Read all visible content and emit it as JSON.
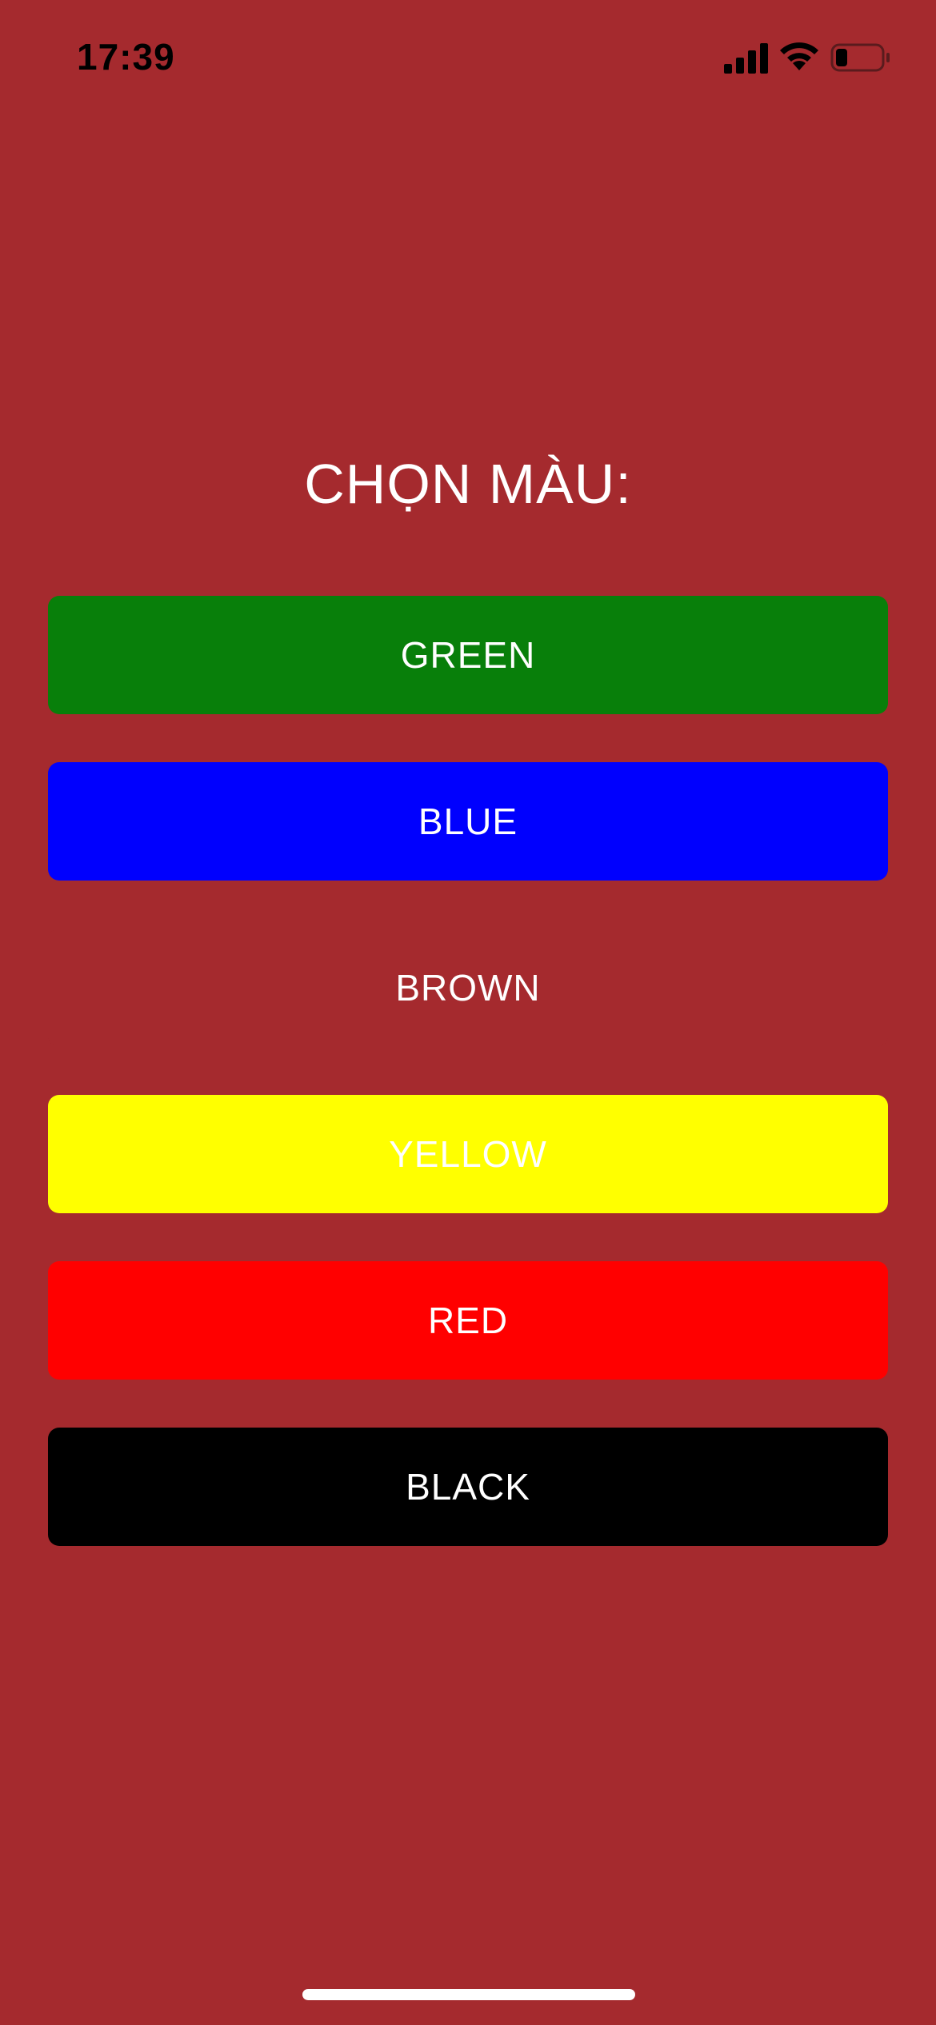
{
  "status_bar": {
    "time": "17:39",
    "icons": [
      "signal-icon",
      "wifi-icon",
      "battery-icon"
    ],
    "battery_level": 0.25
  },
  "title": "CHỌN MÀU:",
  "buttons": [
    {
      "label": "GREEN",
      "color": "#087F0A"
    },
    {
      "label": "BLUE",
      "color": "#0000FE"
    },
    {
      "label": "BROWN",
      "color": "#A52A2E"
    },
    {
      "label": "YELLOW",
      "color": "#FFFF00"
    },
    {
      "label": "RED",
      "color": "#FF0000"
    },
    {
      "label": "BLACK",
      "color": "#000000"
    }
  ],
  "colors": {
    "background": "#A52A2E",
    "text": "#FFFFFF"
  }
}
